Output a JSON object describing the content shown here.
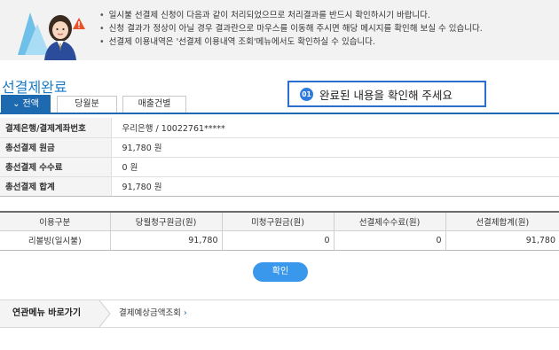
{
  "notice": {
    "lines": [
      "일시불 선결제 신청이 다음과 같이 처리되었으므로 처리결과를 반드시 확인하시기 바랍니다.",
      "신청 결과가 정상이 아닐 경우 결과란으로 마우스를 이동해 주시면 해당 메시지를 확인해 보실 수 있습니다.",
      "선결제 이용내역은 '선결제 이용내역 조회'메뉴에서도 확인하실 수 있습니다."
    ]
  },
  "page_title": "선결제완료",
  "tabs": [
    {
      "label": "전액",
      "active": true
    },
    {
      "label": "당월분",
      "active": false
    },
    {
      "label": "매출건별",
      "active": false
    }
  ],
  "callout": {
    "number": "01",
    "message": "완료된 내용을 확인해 주세요"
  },
  "summary": [
    {
      "label": "결제은행/결제계좌번호",
      "value": "우리은행 / 10022761*****"
    },
    {
      "label": "총선결제 원금",
      "value": "91,780 원"
    },
    {
      "label": "총선결제 수수료",
      "value": "0 원"
    },
    {
      "label": "총선결제 합계",
      "value": "91,780 원"
    }
  ],
  "detail": {
    "headers": [
      "이용구분",
      "당월청구원금(원)",
      "미청구원금(원)",
      "선결제수수료(원)",
      "선결제합계(원)"
    ],
    "rows": [
      [
        "리볼빙(일시불)",
        "91,780",
        "0",
        "0",
        "91,780"
      ]
    ]
  },
  "confirm_label": "확인",
  "related": {
    "label": "연관메뉴 바로가기",
    "link": "결제예상금액조회",
    "link_arrow": "›"
  },
  "colors": {
    "accent": "#1e6ab0",
    "title": "#1b7bc6",
    "button": "#3a98ec",
    "callout_border": "#2d6fd0"
  }
}
